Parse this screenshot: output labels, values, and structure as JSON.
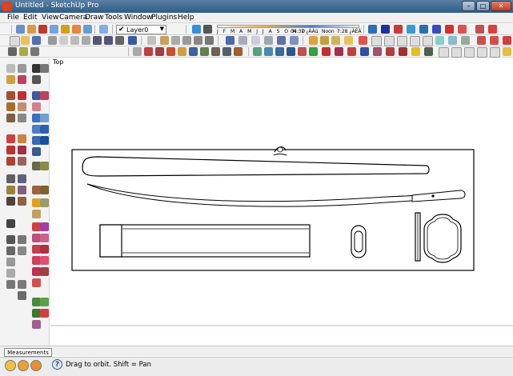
{
  "window": {
    "title": "Untitled - SketchUp Pro",
    "minimize": "–",
    "maximize": "□",
    "close": "✕"
  },
  "menu": [
    "File",
    "Edit",
    "View",
    "Camera",
    "Draw",
    "Tools",
    "Window",
    "Plugins",
    "Help"
  ],
  "layers": {
    "current": "Layer0"
  },
  "shadows": {
    "months": "J F M A M J J A S O N D",
    "time": "04:37 ¿ÀÀü",
    "noon": "Noon",
    "end_time": "7:28 ¿ÀÈÄ"
  },
  "viewport": {
    "view_name": "Top"
  },
  "measurements": {
    "label": "Measurements"
  },
  "status": {
    "help": "?",
    "text": "Drag to orbit.  Shift = Pan"
  }
}
